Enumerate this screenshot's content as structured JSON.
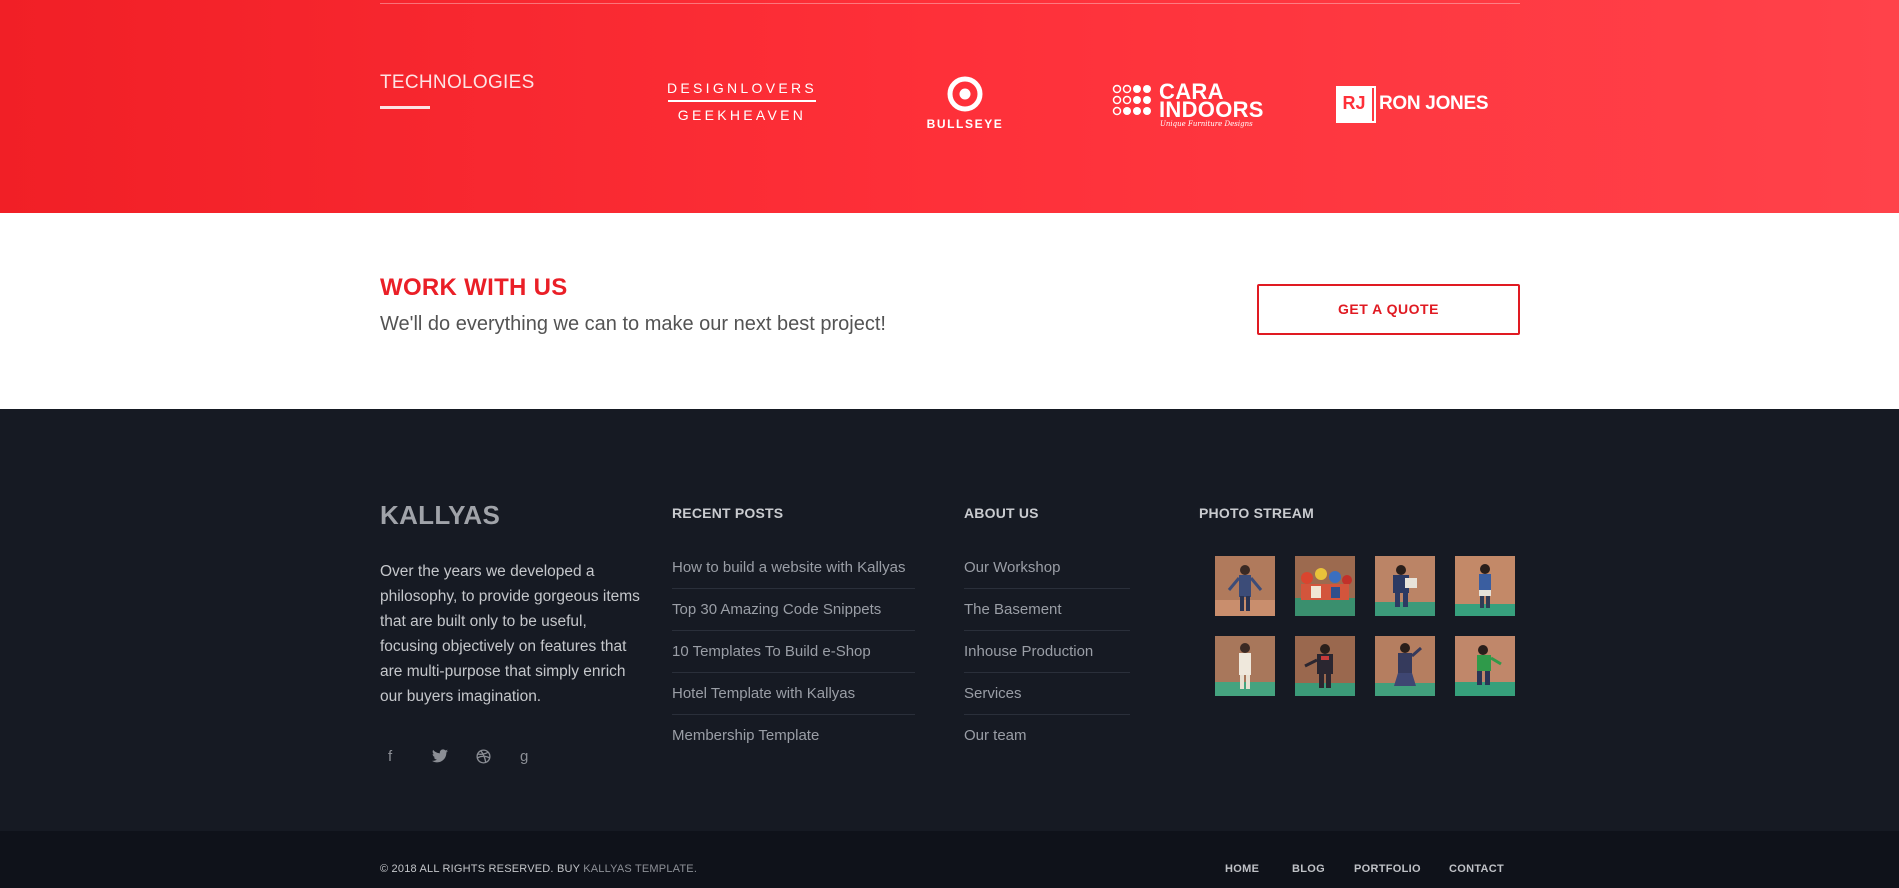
{
  "technologies": {
    "title": "TECHNOLOGIES",
    "logos": {
      "designlovers": {
        "line1": "DESIGNLOVERS",
        "line2": "GEEKHEAVEN"
      },
      "bullseye": {
        "label": "BULLSEYE"
      },
      "cara_indoors": {
        "line1": "CARA",
        "line2": "INDOORS",
        "tagline": "Unique Furniture Designs"
      },
      "ron_jones": {
        "monogram": "RJ",
        "name": "RON JONES"
      }
    },
    "colors": {
      "band_start": "#f11f26",
      "band_end": "#ff424a"
    }
  },
  "work": {
    "title": "WORK WITH US",
    "subtitle": "We'll do everything we can to make our next best project!",
    "button_label": "GET A QUOTE",
    "accent": "#ea1f27"
  },
  "footer": {
    "brand": "KALLYAS",
    "about_text": "Over the years we developed a philosophy, to provide gorgeous items that are built only to be useful, focusing objectively on features that are multi-purpose that simply enrich our buyers imagination.",
    "social_icons": [
      "facebook-icon",
      "twitter-icon",
      "dribbble-icon",
      "google-plus-icon"
    ],
    "social_glyphs": [
      "f",
      "🐦",
      "⚽",
      "g"
    ],
    "recent_posts": {
      "heading": "RECENT POSTS",
      "items": [
        "How to build a website with Kallyas",
        "Top 30 Amazing Code Snippets",
        "10 Templates To Build e-Shop",
        "Hotel Template with Kallyas",
        "Membership Template"
      ]
    },
    "about_us": {
      "heading": "ABOUT US",
      "items": [
        "Our Workshop",
        "The Basement",
        "Inhouse Production",
        "Services",
        "Our team"
      ]
    },
    "photo_stream": {
      "heading": "PHOTO STREAM"
    }
  },
  "bottom_bar": {
    "copyright": "© 2018 ALL RIGHTS RESERVED. BUY",
    "brand_link": "KALLYAS TEMPLATE.",
    "nav": [
      "HOME",
      "BLOG",
      "PORTFOLIO",
      "CONTACT"
    ]
  }
}
